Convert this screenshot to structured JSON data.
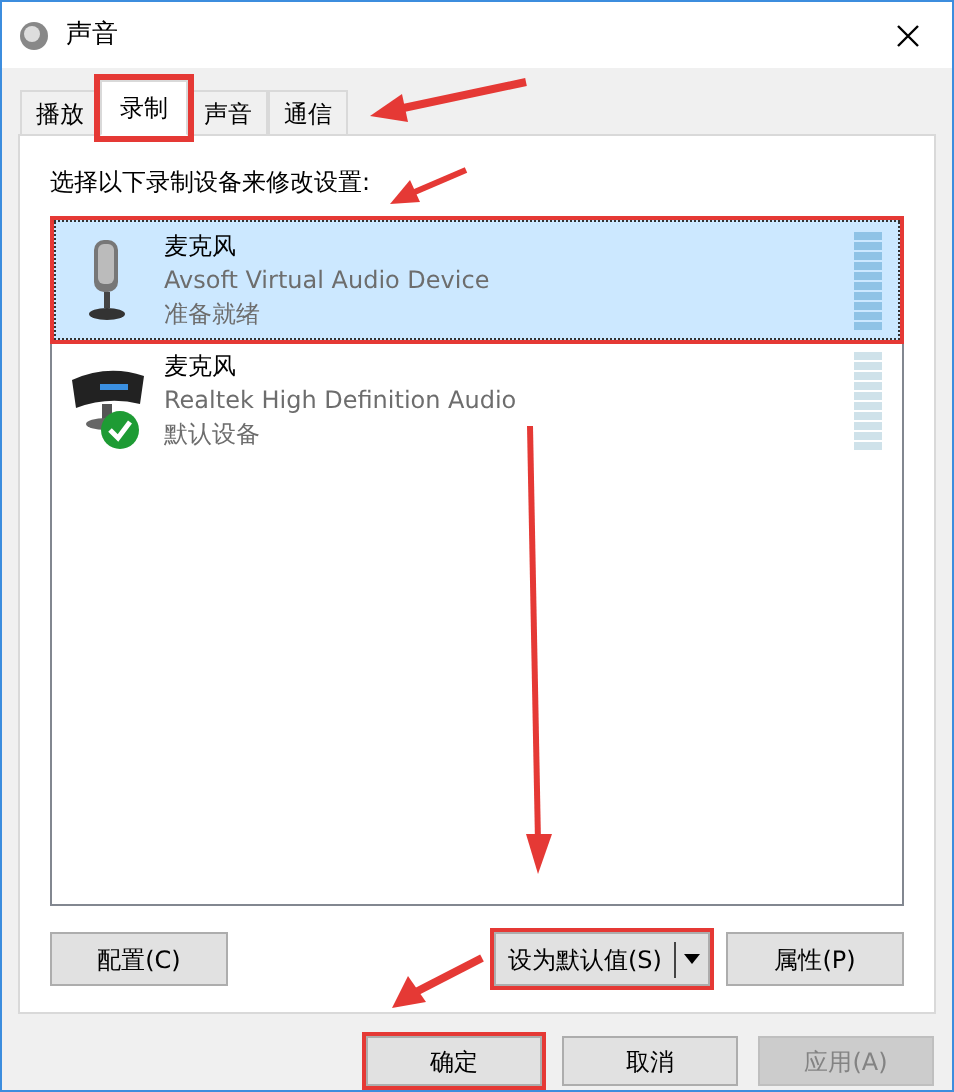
{
  "window": {
    "title": "声音"
  },
  "tabs": [
    {
      "label": "播放",
      "selected": false,
      "highlighted": false
    },
    {
      "label": "录制",
      "selected": true,
      "highlighted": true
    },
    {
      "label": "声音",
      "selected": false,
      "highlighted": false
    },
    {
      "label": "通信",
      "selected": false,
      "highlighted": false
    }
  ],
  "instruction": "选择以下录制设备来修改设置:",
  "devices": [
    {
      "kind": "microphone",
      "name": "麦克风",
      "driver": "Avsoft Virtual Audio Device",
      "status": "准备就绪",
      "selected": true,
      "default": false,
      "highlighted": true
    },
    {
      "kind": "webcam",
      "name": "麦克风",
      "driver": "Realtek High Definition Audio",
      "status": "默认设备",
      "selected": false,
      "default": true,
      "highlighted": false
    }
  ],
  "panel_buttons": [
    {
      "kind": "plain",
      "label": "配置(C)",
      "highlighted": false
    },
    {
      "kind": "split",
      "label": "设为默认值(S)",
      "highlighted": true
    },
    {
      "kind": "plain",
      "label": "属性(P)",
      "highlighted": false
    }
  ],
  "dialog_buttons": [
    {
      "label": "确定",
      "disabled": false,
      "highlighted": true
    },
    {
      "label": "取消",
      "disabled": false,
      "highlighted": false
    },
    {
      "label": "应用(A)",
      "disabled": true,
      "highlighted": false
    }
  ]
}
